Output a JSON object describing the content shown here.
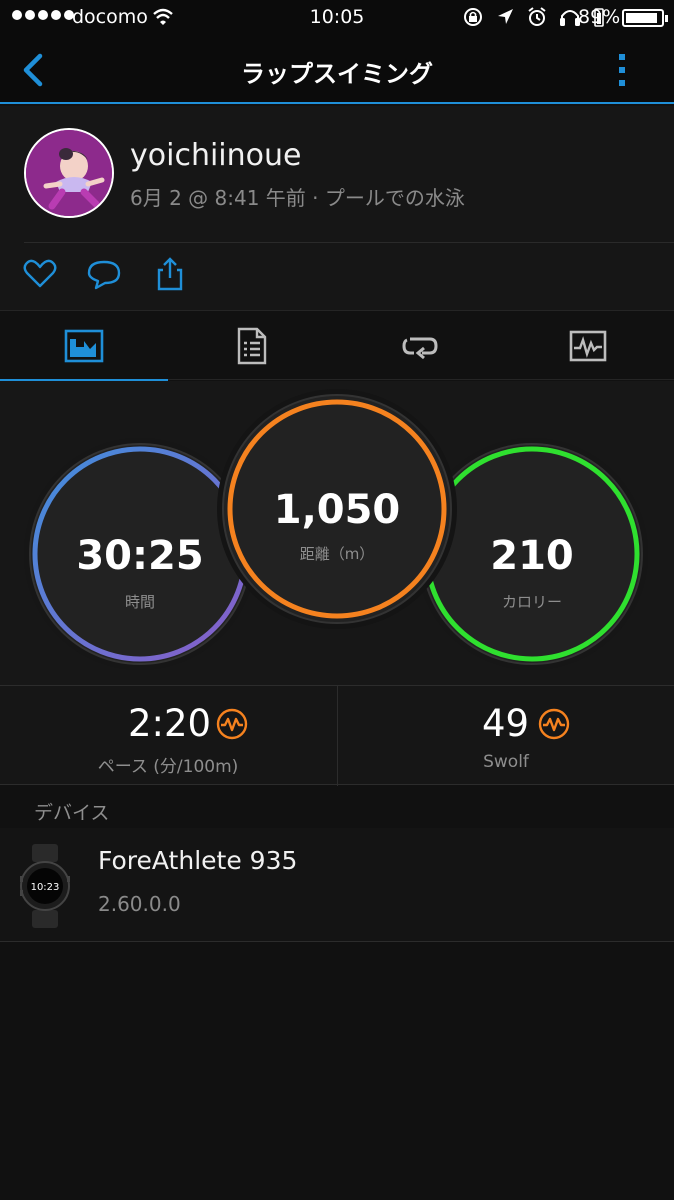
{
  "status_bar": {
    "carrier": "docomo",
    "time": "10:05",
    "battery": "89%"
  },
  "nav": {
    "title": "ラップスイミング"
  },
  "activity": {
    "username": "yoichiinoue",
    "subtitle": "6月 2 @ 8:41 午前 · プールでの水泳"
  },
  "tabs": [
    {
      "icon": "overview-chart-icon",
      "active": true
    },
    {
      "icon": "details-list-icon",
      "active": false
    },
    {
      "icon": "laps-repeat-icon",
      "active": false
    },
    {
      "icon": "graphs-monitor-icon",
      "active": false
    }
  ],
  "gauges": {
    "time": {
      "value": "30:25",
      "label": "時間"
    },
    "distance": {
      "value": "1,050",
      "label": "距離（m）"
    },
    "calories": {
      "value": "210",
      "label": "カロリー"
    }
  },
  "metrics": {
    "pace": {
      "value": "2:20",
      "label": "ペース (分/100m)"
    },
    "swolf": {
      "value": "49",
      "label": "Swolf"
    }
  },
  "devices": {
    "section_label": "デバイス",
    "name": "ForeAthlete 935",
    "version": "2.60.0.0",
    "watch_face_time": "10:23"
  },
  "colors": {
    "accent_blue": "#1f8fd8",
    "distance_orange": "#f5821f",
    "calories_green": "#2fe02f",
    "time_gradient_start": "#3f8fdc",
    "time_gradient_end": "#8a5cc8",
    "pulse_orange": "#f5821f"
  }
}
